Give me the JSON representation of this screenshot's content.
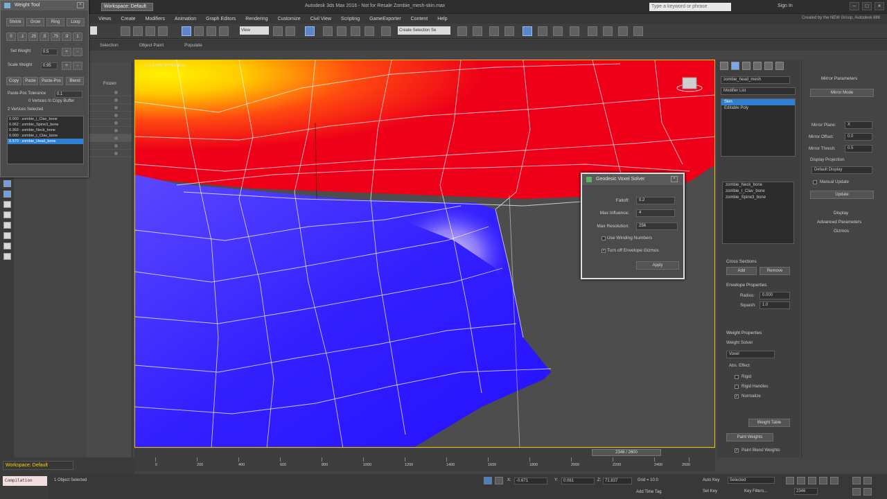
{
  "titlebar": {
    "workspace": "Workspace: Default",
    "title": "Autodesk 3ds Max 2016 - Not for Resale   Zombie_mesh-skin.max",
    "search_placeholder": "Type a keyword or phrase",
    "sign_in": "Sign In"
  },
  "menu": {
    "items": [
      "Views",
      "Create",
      "Modifiers",
      "Animation",
      "Graph Editors",
      "Rendering",
      "Customize",
      "Civil View",
      "Scripting",
      "GameExporter",
      "Content",
      "Help"
    ],
    "credit": "Created by the NEW Group, Autodesk 888"
  },
  "toolbar": {
    "selection_set": "View",
    "named_set": "Create Selection Se"
  },
  "ribbon": {
    "tabs": [
      "Selection",
      "Object Paint",
      "Populate"
    ]
  },
  "weight_tool": {
    "title": "Weight Tool",
    "row1": [
      "Shrink",
      "Grow",
      "Ring",
      "Loop"
    ],
    "row2": [
      "0",
      ".1",
      ".25",
      ".5",
      ".75",
      ".9",
      "1"
    ],
    "set_weight_label": "Set Weight",
    "set_weight_value": "0.5",
    "scale_weight_label": "Scale Weight",
    "scale_weight_value": "0.95",
    "row3": [
      "Copy",
      "Paste",
      "Paste-Pos",
      "Blend"
    ],
    "paste_tol_label": "Paste-Pos Tolerance",
    "paste_tol_value": "0.1",
    "copy_buffer": "0 Vertices In Copy Buffer",
    "selected_verts": "2 Vertices Selected",
    "vertex_weights": [
      "0.000 : zombie_l_Clav_bone",
      "0.062 : zombie_Spine3_bone",
      "0.369 : zombie_Neck_bone",
      "0.000 : zombie_r_Clav_bone",
      "0.570 : zombie_Head_bone"
    ]
  },
  "explorer": {
    "header": "Frozen"
  },
  "viewport": {
    "label": "[+] [Left] [Realistic]"
  },
  "geodesic": {
    "title": "Geodesic Voxel Solver",
    "falloff_label": "Falloff:",
    "falloff_value": "0.2",
    "max_influence_label": "Max Influence:",
    "max_influence_value": "4",
    "max_resolution_label": "Max Resolution:",
    "max_resolution_value": "256",
    "use_winding_label": "Use Winding Numbers",
    "turn_off_envelope_label": "Turn off Envelope Gizmos",
    "apply_label": "Apply"
  },
  "command_panel": {
    "object_name": "zombie_head_mesh",
    "modifier_list": "Modifier List",
    "stack": [
      "Skin",
      "Editable Poly"
    ],
    "bones": [
      "zombie_Neck_bone",
      "zombie_r_Clav_bone",
      "zombie_Spine3_bone"
    ],
    "cross_sections": "Cross Sections",
    "add": "Add",
    "remove": "Remove",
    "envelope_properties": "Envelope Properties",
    "radius_label": "Radius:",
    "radius_value": "0.000",
    "squash_label": "Squash:",
    "squash_value": "1.0",
    "weight_properties": "Weight Properties",
    "weight_solver": "Weight Solver",
    "solver_value": "Voxel",
    "abs_effect": "Abs. Effect",
    "rigid": "Rigid",
    "rigid_handles": "Rigid Handles",
    "normalize": "Normalize",
    "weight_table": "Weight Table",
    "paint_weights": "Paint Weights",
    "paint_blend": "Paint Blend Weights"
  },
  "mirror_panel": {
    "header": "Mirror Parameters",
    "mirror_mode": "Mirror Mode",
    "mirror_plane_label": "Mirror Plane:",
    "mirror_plane_value": "X",
    "mirror_offset_label": "Mirror Offset:",
    "mirror_offset_value": "0.0",
    "mirror_thresh_label": "Mirror Thresh:",
    "mirror_thresh_value": "0.5",
    "display_projection": "Display Projection",
    "default_display": "Default Display",
    "manual_update": "Manual Update",
    "update": "Update",
    "rollouts": [
      "Display",
      "Advanced Parameters",
      "Gizmos"
    ]
  },
  "timeline": {
    "slider": "2346 / 2600",
    "ticks": [
      "0",
      "200",
      "400",
      "600",
      "800",
      "1000",
      "1200",
      "1400",
      "1600",
      "1800",
      "2000",
      "2200",
      "2400",
      "2600"
    ]
  },
  "status": {
    "workspace": "Workspace: Default",
    "maxscript": "Compilation",
    "selected": "1 Object Selected",
    "x_label": "X:",
    "x_value": "-0.671",
    "y_label": "Y:",
    "y_value": "0.061",
    "z_label": "Z:",
    "z_value": "71.837",
    "grid": "Grid = 10.0",
    "add_time_tag": "Add Time Tag",
    "auto_key": "Auto Key",
    "set_key": "Set Key",
    "selected_dropdown": "Selected",
    "key_filters": "Key Filters...",
    "frame": "2346"
  },
  "colors": {
    "accent_blue": "#2f80d1",
    "viewport_border": "#eec600",
    "mesh_red": "#e8001a",
    "mesh_blue": "#2410ff",
    "mesh_yellow": "#ffe500"
  }
}
